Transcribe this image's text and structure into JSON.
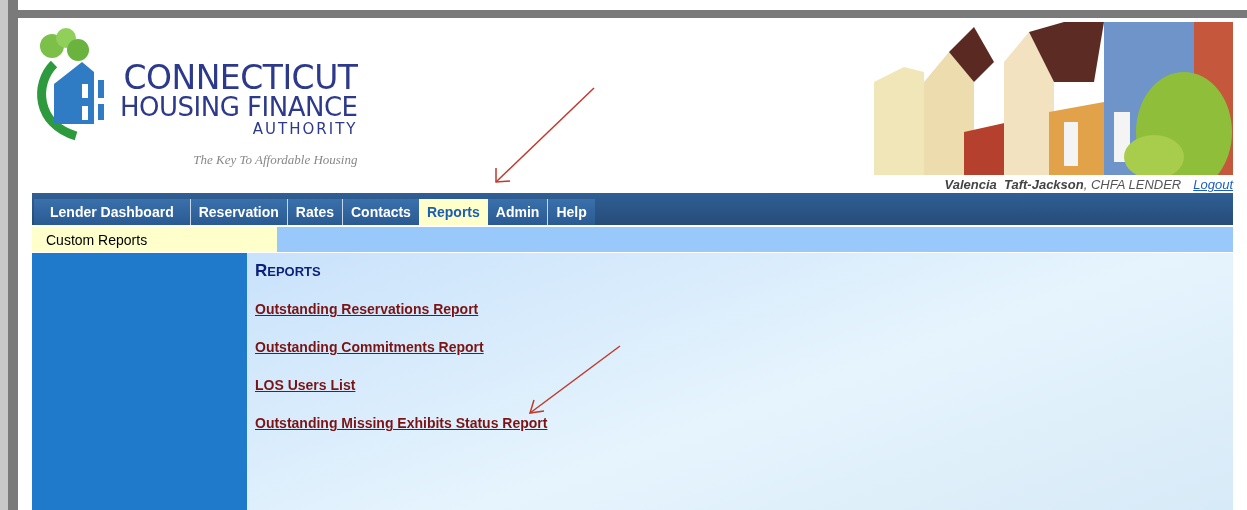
{
  "header": {
    "logo": {
      "line_1": "CONNECTICUT",
      "line_2": "HOUSING FINANCE",
      "line_3": "AUTHORITY",
      "tagline": "The Key To Affordable Housing"
    },
    "user": {
      "text": "**Valencia  Taft-Jackson**, CHFA LENDER",
      "logout": "Logout"
    }
  },
  "nav": [
    {
      "label": "Lender Dashboard",
      "selected": false
    },
    {
      "label": "Reservation",
      "selected": false
    },
    {
      "label": "Rates",
      "selected": false
    },
    {
      "label": "Contacts",
      "selected": false
    },
    {
      "label": "Reports",
      "selected": true
    },
    {
      "label": "Admin",
      "selected": false
    },
    {
      "label": "Help",
      "selected": false
    }
  ],
  "subnav": [
    {
      "label": "Custom Reports",
      "selected": true
    }
  ],
  "content": {
    "title": "REPORTS",
    "links": [
      "Outstanding Reservations Report",
      "Outstanding Commitments Report",
      "LOS Users List",
      "Outstanding Missing Exhibits Status Report"
    ]
  }
}
